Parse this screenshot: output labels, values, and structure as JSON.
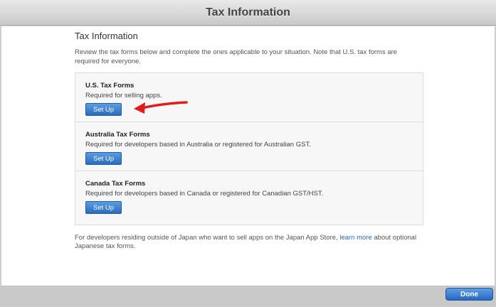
{
  "window": {
    "title": "Tax Information"
  },
  "main": {
    "title": "Tax Information",
    "intro": "Review the tax forms below and complete the ones applicable to your situation. Note that U.S. tax forms are required for everyone.",
    "forms": [
      {
        "title": "U.S. Tax Forms",
        "description": "Required for selling apps.",
        "button": "Set Up"
      },
      {
        "title": "Australia Tax Forms",
        "description": "Required for developers based in Australia or registered for Australian GST.",
        "button": "Set Up"
      },
      {
        "title": "Canada Tax Forms",
        "description": "Required for developers based in Canada or registered for Canadian GST/HST.",
        "button": "Set Up"
      }
    ],
    "footer": {
      "before_link": "For developers residing outside of Japan who want to sell apps on the Japan App Store, ",
      "link": "learn more",
      "after_link": " about optional Japanese tax forms."
    }
  },
  "bottom_bar": {
    "done_label": "Done"
  },
  "annotation": {
    "icon": "red-arrow-icon",
    "color": "#e21b1b"
  }
}
